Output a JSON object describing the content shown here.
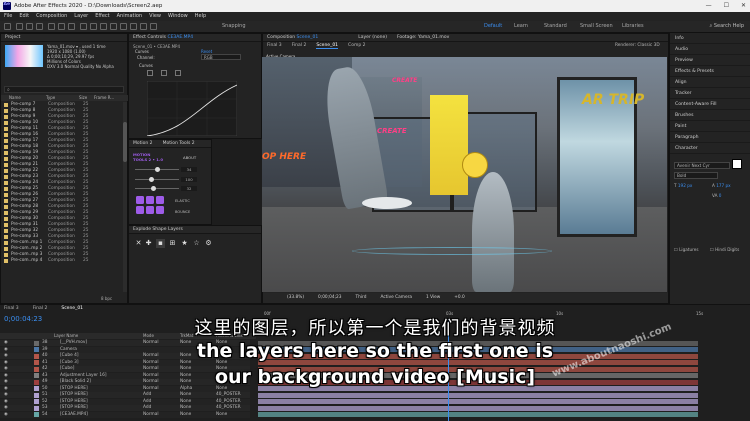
{
  "window": {
    "title": "Adobe After Effects 2020 - D:\\Downloads\\Screen2.aep"
  },
  "menu": [
    "File",
    "Edit",
    "Composition",
    "Layer",
    "Effect",
    "Animation",
    "View",
    "Window",
    "Help"
  ],
  "toolbar": {
    "snapping": "Snapping",
    "workspaces": [
      "Default",
      "Learn",
      "Standard",
      "Small Screen",
      "Libraries"
    ],
    "active_workspace": "Default",
    "search": "Search Help"
  },
  "project": {
    "panel_title": "Project",
    "selected_name": "Yama_01.mov",
    "selected_info": "Yama_01.mov ▾ , used 1 time",
    "selected_dims": "1920 x 1080 (1.00)",
    "selected_duration": "Δ 0;00;10;29, 29.97 fps",
    "selected_colors": "Millions of Colors",
    "selected_codec": "DXV 3.0 Normal Quality No Alpha",
    "columns": {
      "name": "Name",
      "type": "Type",
      "size": "Size",
      "frame_rate": "Frame R..."
    },
    "items": [
      {
        "name": "Pre-comp 7",
        "type": "Composition",
        "fps": "25"
      },
      {
        "name": "Pre-comp 8",
        "type": "Composition",
        "fps": "25"
      },
      {
        "name": "Pre-comp 9",
        "type": "Composition",
        "fps": "25"
      },
      {
        "name": "Pre-comp 10",
        "type": "Composition",
        "fps": "25"
      },
      {
        "name": "Pre-comp 11",
        "type": "Composition",
        "fps": "25"
      },
      {
        "name": "Pre-comp 16",
        "type": "Composition",
        "fps": "25"
      },
      {
        "name": "Pre-comp 17",
        "type": "Composition",
        "fps": "25"
      },
      {
        "name": "Pre-comp 18",
        "type": "Composition",
        "fps": "25"
      },
      {
        "name": "Pre-comp 19",
        "type": "Composition",
        "fps": "25"
      },
      {
        "name": "Pre-comp 20",
        "type": "Composition",
        "fps": "25"
      },
      {
        "name": "Pre-comp 21",
        "type": "Composition",
        "fps": "25"
      },
      {
        "name": "Pre-comp 22",
        "type": "Composition",
        "fps": "25"
      },
      {
        "name": "Pre-comp 23",
        "type": "Composition",
        "fps": "25"
      },
      {
        "name": "Pre-comp 24",
        "type": "Composition",
        "fps": "25"
      },
      {
        "name": "Pre-comp 25",
        "type": "Composition",
        "fps": "25"
      },
      {
        "name": "Pre-comp 26",
        "type": "Composition",
        "fps": "25"
      },
      {
        "name": "Pre-comp 27",
        "type": "Composition",
        "fps": "25"
      },
      {
        "name": "Pre-comp 28",
        "type": "Composition",
        "fps": "25"
      },
      {
        "name": "Pre-comp 29",
        "type": "Composition",
        "fps": "25"
      },
      {
        "name": "Pre-comp 30",
        "type": "Composition",
        "fps": "25"
      },
      {
        "name": "Pre-comp 31",
        "type": "Composition",
        "fps": "25"
      },
      {
        "name": "Pre-comp 32",
        "type": "Composition",
        "fps": "25"
      },
      {
        "name": "Pre-comp 33",
        "type": "Composition",
        "fps": "25"
      },
      {
        "name": "Pre-com..mp 1",
        "type": "Composition",
        "fps": "25"
      },
      {
        "name": "Pre-com..mp 2",
        "type": "Composition",
        "fps": "25"
      },
      {
        "name": "Pre-com..mp 3",
        "type": "Composition",
        "fps": "25"
      },
      {
        "name": "Pre-com..mp 4",
        "type": "Composition",
        "fps": "25"
      }
    ],
    "bpc": "8 bpc"
  },
  "effect_controls": {
    "tab": "Effect Controls",
    "layer": "CE3AE.MP4",
    "path": "Scene_01 • CE3AE.MP4",
    "reset": "Reset",
    "curves": "Curves",
    "channel_label": "Channel:",
    "channel_value": "RGB"
  },
  "motion": {
    "tab1": "Motion 2",
    "tab2": "Motion Tools 2",
    "about": "ABOUT",
    "brand": "MOTION",
    "version": "TOOLS 2 • 1.0",
    "values": [
      "34",
      "100",
      "32"
    ],
    "elastic": "ELASTIC",
    "bounce": "BOUNCE"
  },
  "explode": {
    "title": "Explode Shape Layers"
  },
  "composition": {
    "tabs": [
      "Final 3",
      "Final 2",
      "Scene_01",
      "Comp 2"
    ],
    "active_tab": "Scene_01",
    "comp_label": "Composition",
    "comp_name": "Scene_01",
    "layer_label": "Layer (none)",
    "footage_label": "Footage: Yama_01.mov",
    "renderer_label": "Renderer:",
    "renderer": "Classic 3D",
    "camera_label": "Active Camera",
    "zoom": "(33.8%)",
    "timecode": "0;00;04;23",
    "resolution": "Third",
    "camera": "Active Camera",
    "views": "1 View",
    "plus": "+0.0"
  },
  "scene": {
    "sign1": "OP HERE",
    "sign2": "CREATE",
    "sign3": "CREATE",
    "sign4": "AR TRIP"
  },
  "right_panel": {
    "items": [
      "Info",
      "Audio",
      "Preview",
      "Effects & Presets",
      "Align",
      "Tracker",
      "Content-Aware Fill",
      "Brushes",
      "Paint",
      "Paragraph",
      "Character"
    ],
    "font": "Avenir Next Cyr",
    "style": "Bold",
    "size": "192 px",
    "leading": "177 px",
    "tracking": "0",
    "ligatures": "Ligatures",
    "hindi": "Hindi Digits"
  },
  "timeline": {
    "tabs": [
      "Final 3",
      "Final 2",
      "Scene_01"
    ],
    "active_tab": "Scene_01",
    "timecode": "0;00:04:23",
    "layer_name_header": "Layer Name",
    "mode_header": "Mode",
    "trkmat_header": "TrkMat",
    "parent_header": "Parent & Link",
    "layers": [
      {
        "num": "38",
        "name": "[__PVH.mov]",
        "mode": "Normal",
        "trk": "None",
        "parent": "None"
      },
      {
        "num": "39",
        "name": "Camera",
        "mode": "",
        "trk": "",
        "parent": "None"
      },
      {
        "num": "40",
        "name": "[Cube 4]",
        "mode": "Normal",
        "trk": "None",
        "parent": "None"
      },
      {
        "num": "41",
        "name": "[Cube 3]",
        "mode": "Normal",
        "trk": "None",
        "parent": "None"
      },
      {
        "num": "42",
        "name": "[Cube]",
        "mode": "Normal",
        "trk": "None",
        "parent": "None"
      },
      {
        "num": "43",
        "name": "Adjustment Layer 16]",
        "mode": "Normal",
        "trk": "None",
        "parent": "None"
      },
      {
        "num": "49",
        "name": "[Black Solid 2]",
        "mode": "Normal",
        "trk": "None",
        "parent": "None"
      },
      {
        "num": "50",
        "name": "[STOP HERE]",
        "mode": "Normal",
        "trk": "Alpha",
        "parent": "None"
      },
      {
        "num": "51",
        "name": "[STOP HERE]",
        "mode": "Add",
        "trk": "None",
        "parent": "40_POSTER"
      },
      {
        "num": "52",
        "name": "[STOP HERE]",
        "mode": "Add",
        "trk": "None",
        "parent": "40_POSTER"
      },
      {
        "num": "53",
        "name": "[STOP HERE]",
        "mode": "Add",
        "trk": "None",
        "parent": "40_POSTER"
      },
      {
        "num": "54",
        "name": "[CE3AE.MP4]",
        "mode": "Normal",
        "trk": "None",
        "parent": "None"
      }
    ],
    "ruler": [
      "00f",
      "03s",
      "10s",
      "15s"
    ]
  },
  "subtitles": {
    "chinese": "这里的图层，所以第一个是我们的背景视频",
    "english_line1": "the layers here so the first one is",
    "english_line2": "our background video [Music]",
    "watermark": "www.aboutnaoshi.com"
  }
}
